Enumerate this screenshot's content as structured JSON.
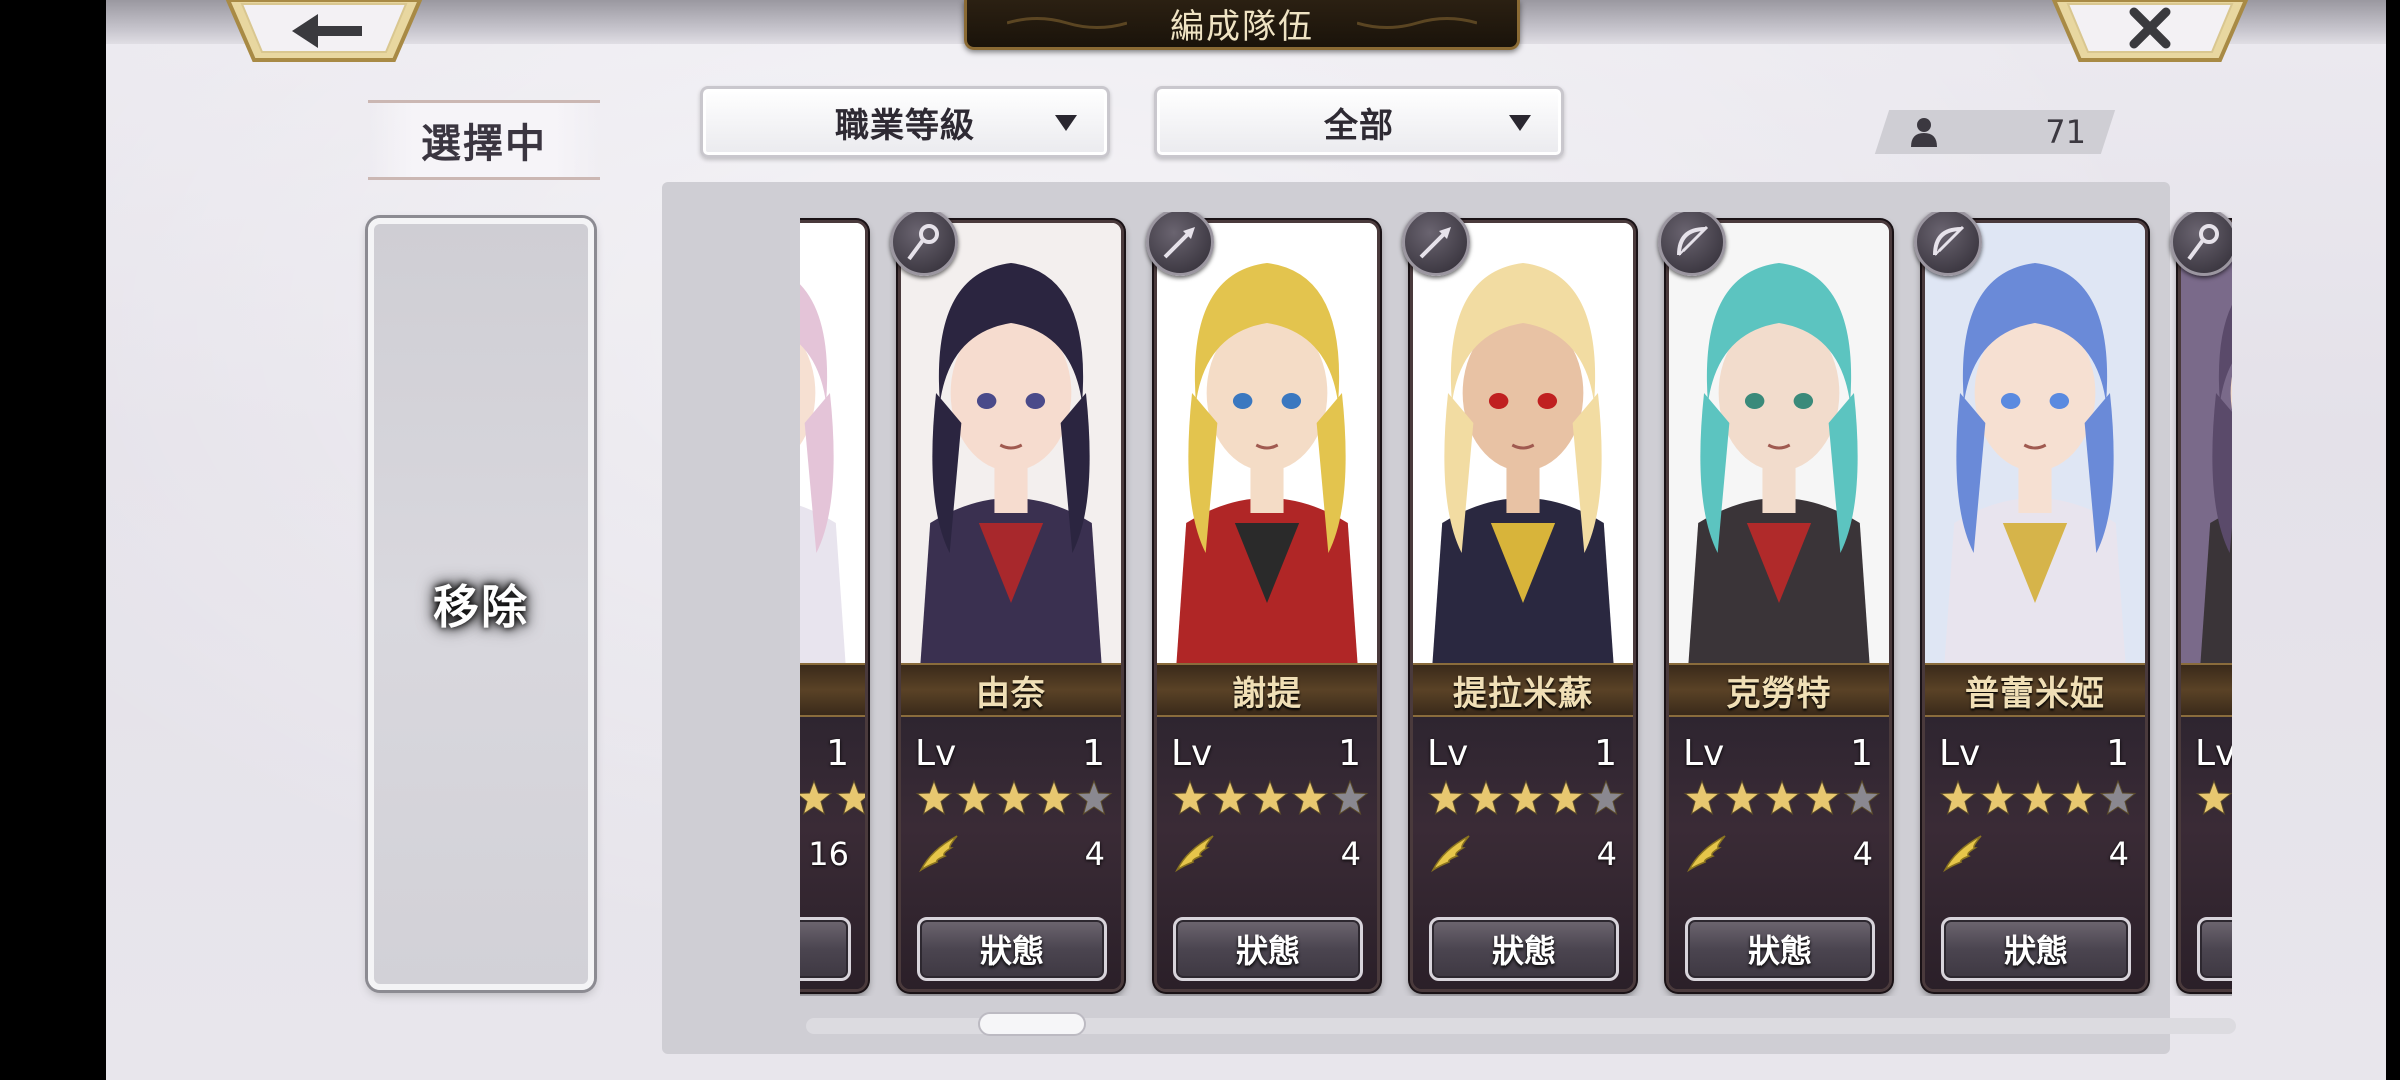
{
  "header": {
    "title": "編成隊伍",
    "back_icon": "arrow-left-icon",
    "close_icon": "close-x-icon"
  },
  "selected_panel": {
    "title": "選擇中",
    "remove_label": "移除"
  },
  "filters": {
    "sort_label": "職業等級",
    "filter_label": "全部"
  },
  "unit_count": {
    "icon": "person-icon",
    "value": "71"
  },
  "partial_left_card": {
    "level": "1",
    "rank": "16"
  },
  "cards": [
    {
      "name": "由奈",
      "lv_label": "Lv",
      "level": "1",
      "stars": 4,
      "max_stars": 5,
      "rank": "4",
      "status_label": "狀態",
      "class_icon": "staff-icon",
      "palette": "dark-hair-red-bow"
    },
    {
      "name": "謝提",
      "lv_label": "Lv",
      "level": "1",
      "stars": 4,
      "max_stars": 5,
      "rank": "4",
      "status_label": "狀態",
      "class_icon": "spear-icon",
      "palette": "blonde-red-shirt"
    },
    {
      "name": "提拉米蘇",
      "lv_label": "Lv",
      "level": "1",
      "stars": 4,
      "max_stars": 5,
      "rank": "4",
      "status_label": "狀態",
      "class_icon": "spear-icon",
      "palette": "blonde-red-eyes"
    },
    {
      "name": "克勞特",
      "lv_label": "Lv",
      "level": "1",
      "stars": 4,
      "max_stars": 5,
      "rank": "4",
      "status_label": "狀態",
      "class_icon": "bow-icon",
      "palette": "teal-hair"
    },
    {
      "name": "普蕾米婭",
      "lv_label": "Lv",
      "level": "1",
      "stars": 4,
      "max_stars": 5,
      "rank": "4",
      "status_label": "狀態",
      "class_icon": "bow-icon",
      "palette": "rainbow-hair"
    }
  ],
  "partial_right_card": {
    "lv_label": "Lv",
    "class_icon": "staff-icon"
  },
  "colors": {
    "gold_star": "#e8c870",
    "grey_star": "#8a8890",
    "nameplate_text": "#f0dfb6",
    "title_text": "#efe3c3"
  }
}
